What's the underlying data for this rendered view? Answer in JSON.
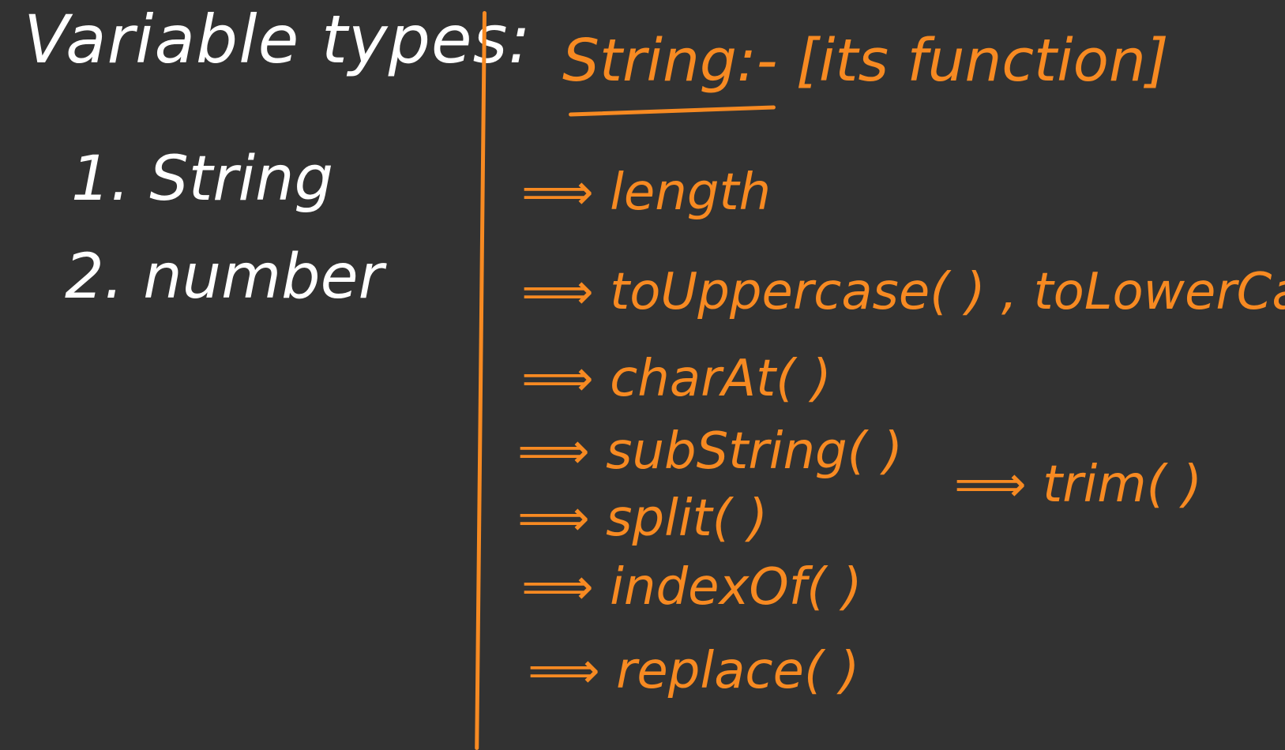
{
  "left": {
    "title": "Variable types:",
    "items": [
      "1. String",
      "2. number"
    ]
  },
  "right": {
    "title": "String:- [its function]",
    "methods": [
      "⟹ length",
      "⟹ toUppercase( ) , toLowerCase()",
      "⟹ charAt( )",
      "⟹ subString( )",
      "⟹ split( )",
      "⟹ indexOf( )",
      "⟹ replace( )"
    ],
    "side_method": "⟹ trim( )"
  },
  "colors": {
    "background": "#323232",
    "left_ink": "#ffffff",
    "right_ink": "#f78a22"
  }
}
